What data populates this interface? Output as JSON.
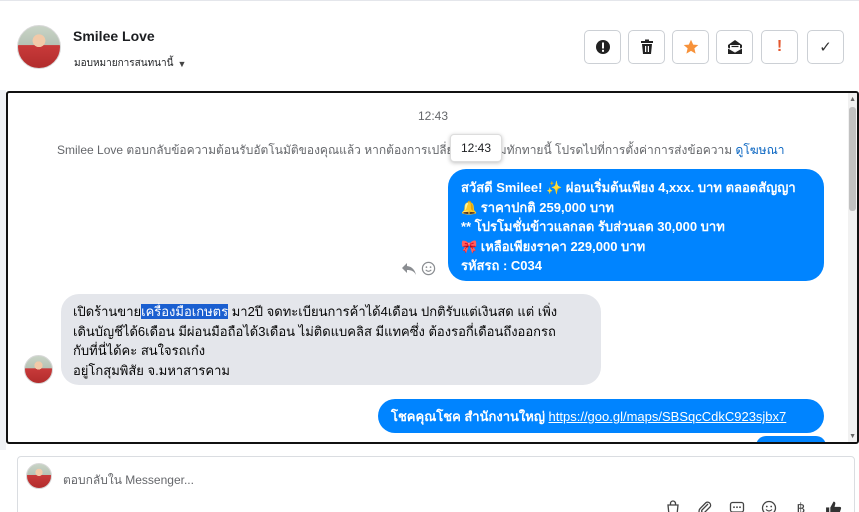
{
  "header": {
    "user_name": "Smilee Love",
    "assign_label": "มอบหมายการสนทนานี้",
    "actions": [
      {
        "name": "mark-spam",
        "icon": "alert-circle-icon"
      },
      {
        "name": "delete",
        "icon": "trash-icon"
      },
      {
        "name": "star",
        "icon": "star-icon",
        "color": "#f7923a"
      },
      {
        "name": "archive",
        "icon": "mail-archive-icon"
      },
      {
        "name": "mark-important",
        "icon": "exclamation-icon",
        "label": "!",
        "color": "#e4572e"
      },
      {
        "name": "mark-done",
        "icon": "check-icon",
        "label": "✓"
      }
    ]
  },
  "conversation": {
    "timestamp": "12:43",
    "tooltip": "12:43",
    "notice_text": "Smilee Love ตอบกลับข้อความต้อนรับอัตโนมัติของคุณแล้ว หากต้องการเปลี่ยนข้อความทักทายนี้ โปรดไปที่การตั้งค่าการส่งข้อความ",
    "notice_link": "ดูโฆษณา",
    "outgoing_1": {
      "lines": [
        "สวัสดี Smilee! ✨  ผ่อนเริ่มต้นเพียง 4,xxx. บาท ตลอดสัญญา",
        "🔔 ราคาปกติ 259,000 บาท",
        "** โปรโมชั่นข้าวแลกลด รับส่วนลด 30,000 บาท",
        "🎀  เหลือเพียงราคา 229,000 บาท",
        " รหัสรถ : C034"
      ]
    },
    "incoming_1": {
      "line1_before": "เปิดร้านขาย",
      "line1_highlight": "เครื่องมือเกษตร",
      "line1_after": " มา2ปี จดทะเบียนการค้าได้4เดือน ปกติรับแต่เงินสด แต่ เพิ่ง",
      "line2": "เดินบัญชีได้6เดือน มีผ่อนมือถือได้3เดือน ไม่ติดแบคลิส มีแทคซึ่ง ต้องรอกี่เดือนถึงออกรถ",
      "line3": "กับที่นี่ได้คะ สนใจรถเก๋ง",
      "line4": "อยู่โกสุมพิสัย จ.มหาสารคาม"
    },
    "outgoing_2": {
      "label": "โชคคุณโชค สำนักงานใหญ่",
      "link": "https://goo.gl/maps/SBSqcCdkC923sjbx7"
    }
  },
  "composer": {
    "placeholder": "ตอบกลับใน Messenger...",
    "tools": [
      "shopping-bag-icon",
      "attachment-icon",
      "saved-reply-icon",
      "emoji-icon",
      "baht-icon",
      "thumbs-up-icon"
    ]
  },
  "colors": {
    "outgoing_bubble": "#0084ff",
    "incoming_bubble": "#e4e6eb",
    "link": "#0a66c2",
    "highlight": "#1a5fd0"
  }
}
